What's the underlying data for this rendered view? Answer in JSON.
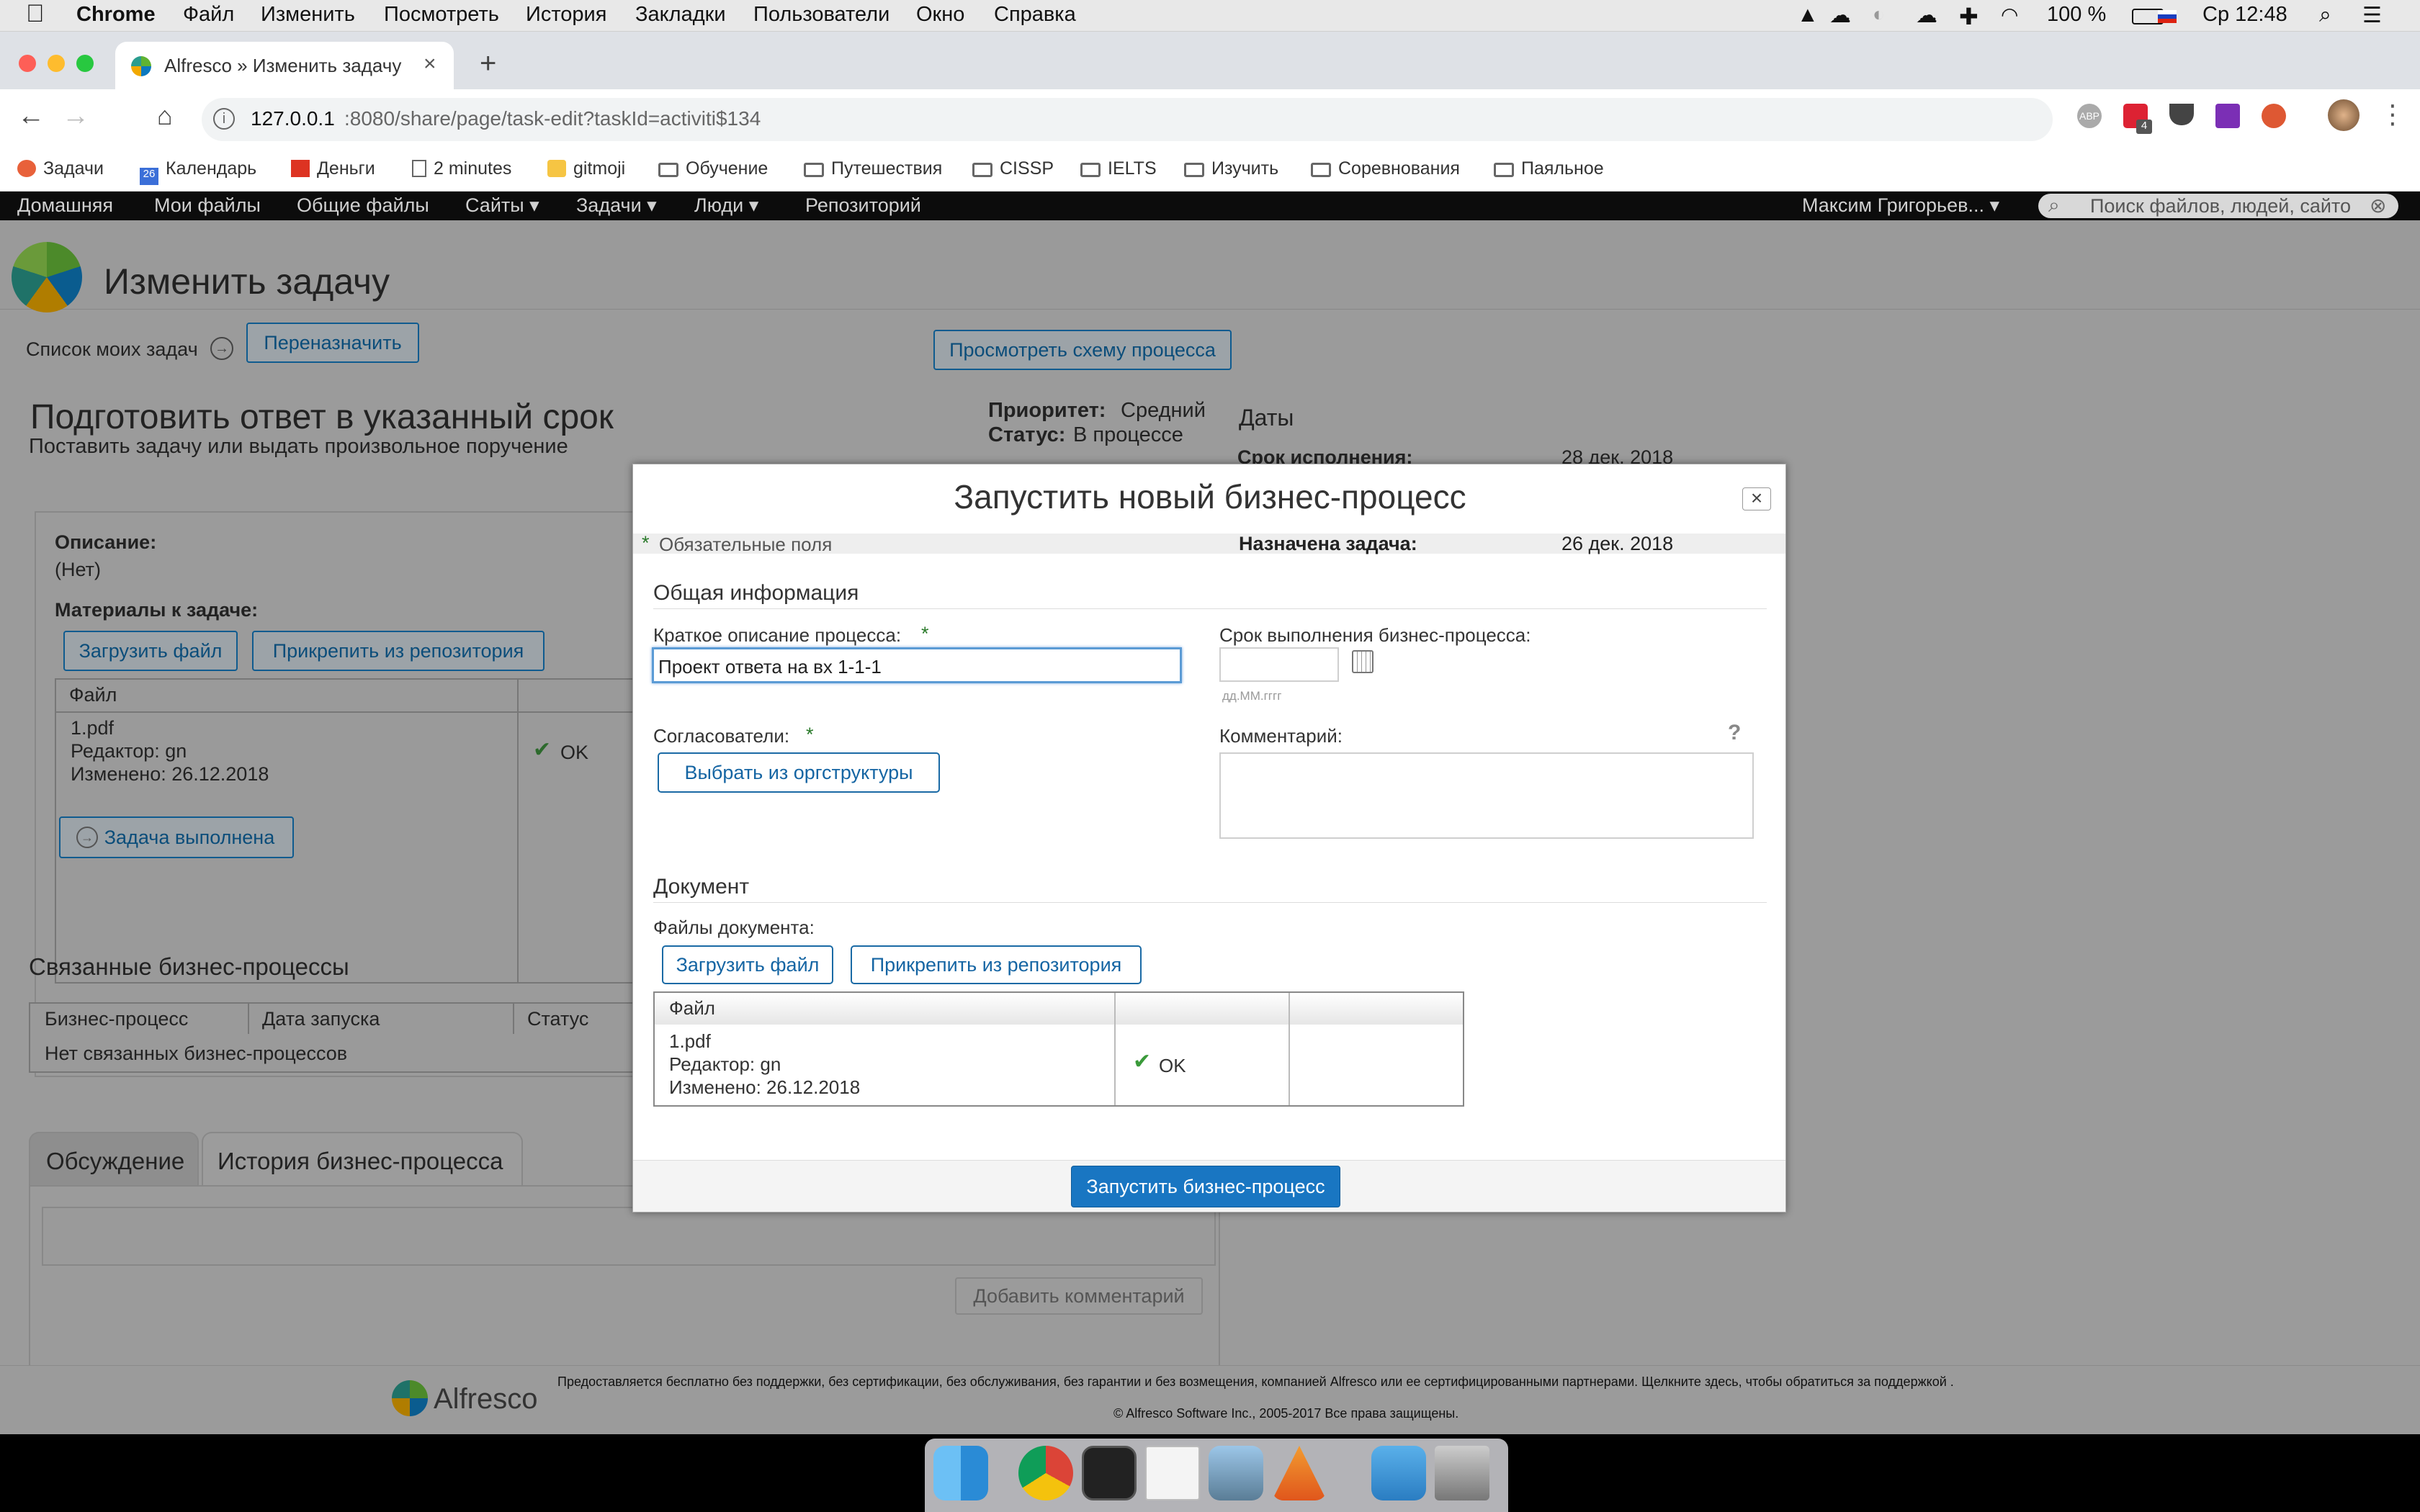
{
  "menubar": {
    "app": "Chrome",
    "items": [
      "Файл",
      "Изменить",
      "Посмотреть",
      "История",
      "Закладки",
      "Пользователи",
      "Окно",
      "Справка"
    ],
    "battery": "100 %",
    "clock": "Ср 12:48"
  },
  "browser": {
    "tab_title": "Alfresco » Изменить задачу",
    "url_host": "127.0.0.1",
    "url_rest": ":8080/share/page/task-edit?taskId=activiti$134",
    "ext_badge": "4",
    "bookmarks": [
      "Задачи",
      "Календарь",
      "Деньги",
      "2 minutes",
      "gitmoji",
      "Обучение",
      "Путешествия",
      "CISSP",
      "IELTS",
      "Изучить",
      "Соревнования",
      "Паяльное"
    ],
    "calendar_day": "26"
  },
  "appnav": {
    "items": [
      "Домашняя",
      "Мои файлы",
      "Общие файлы",
      "Сайты ▾",
      "Задачи ▾",
      "Люди ▾",
      "Репозиторий"
    ],
    "user": "Максим Григорьев... ▾",
    "search_placeholder": "Поиск файлов, людей, сайто"
  },
  "page": {
    "title": "Изменить задачу",
    "my_tasks_link": "Список моих задач",
    "reassign_button": "Переназначить",
    "view_scheme_button": "Просмотреть схему процесса",
    "task_title": "Подготовить ответ в указанный срок",
    "task_subtitle": "Поставить задачу или выдать произвольное поручение",
    "priority_label": "Приоритет:",
    "priority_value": "Средний",
    "status_label": "Статус:",
    "status_value": "В процессе",
    "dates_heading": "Даты",
    "due_label": "Срок исполнения:",
    "due_value": "28 дек. 2018",
    "assigned_label": "Назначена задача:",
    "assigned_value": "26 дек. 2018",
    "description_label": "Описание:",
    "description_value": "(Нет)",
    "materials_label": "Материалы к задаче:",
    "upload_button": "Загрузить файл",
    "attach_button": "Прикрепить из репозитория",
    "file_col": "Файл",
    "file_name": "1.pdf",
    "file_editor": "Редактор: gn",
    "file_modified": "Изменено: 26.12.2018",
    "file_status": "OK",
    "done_button": "Задача выполнена",
    "related_heading": "Связанные бизнес-процессы",
    "related_cols": [
      "Бизнес-процесс",
      "Дата запуска",
      "Статус"
    ],
    "related_empty": "Нет связанных бизнес-процессов",
    "tab_discussion": "Обсуждение",
    "tab_history": "История бизнес-процесса",
    "add_comment_button": "Добавить комментарий"
  },
  "dialog": {
    "title": "Запустить новый бизнес-процесс",
    "required_note": "Обязательные поля",
    "general_heading": "Общая информация",
    "short_desc_label": "Краткое описание процесса:",
    "short_desc_value": "Проект ответа на вх 1-1-1",
    "deadline_label": "Срок выполнения бизнес-процесса:",
    "date_hint": "дд.ММ.гггг",
    "approvers_label": "Согласователи:",
    "select_org_button": "Выбрать из оргструктуры",
    "comment_label": "Комментарий:",
    "help_mark": "?",
    "document_heading": "Документ",
    "doc_files_label": "Файлы документа:",
    "upload_button": "Загрузить файл",
    "attach_button": "Прикрепить из репозитория",
    "file_col": "Файл",
    "file_name": "1.pdf",
    "file_editor": "Редактор: gn",
    "file_modified": "Изменено: 26.12.2018",
    "file_status": "OK",
    "start_button": "Запустить бизнес-процесс",
    "close": "×"
  },
  "footer": {
    "brand": "Alfresco",
    "notice": "Предоставляется бесплатно без поддержки, без сертификации, без обслуживания, без гарантии и без возмещения, компанией Alfresco или ее сертифицированными партнерами. Щелкните здесь, чтобы обратиться за поддержкой .",
    "copyright": "© Alfresco Software Inc., 2005-2017 Все права защищены."
  },
  "colors": {
    "accent": "#1976c2",
    "alfresco_green": "#5fb332",
    "dim_bg": "#9b9b9b"
  }
}
